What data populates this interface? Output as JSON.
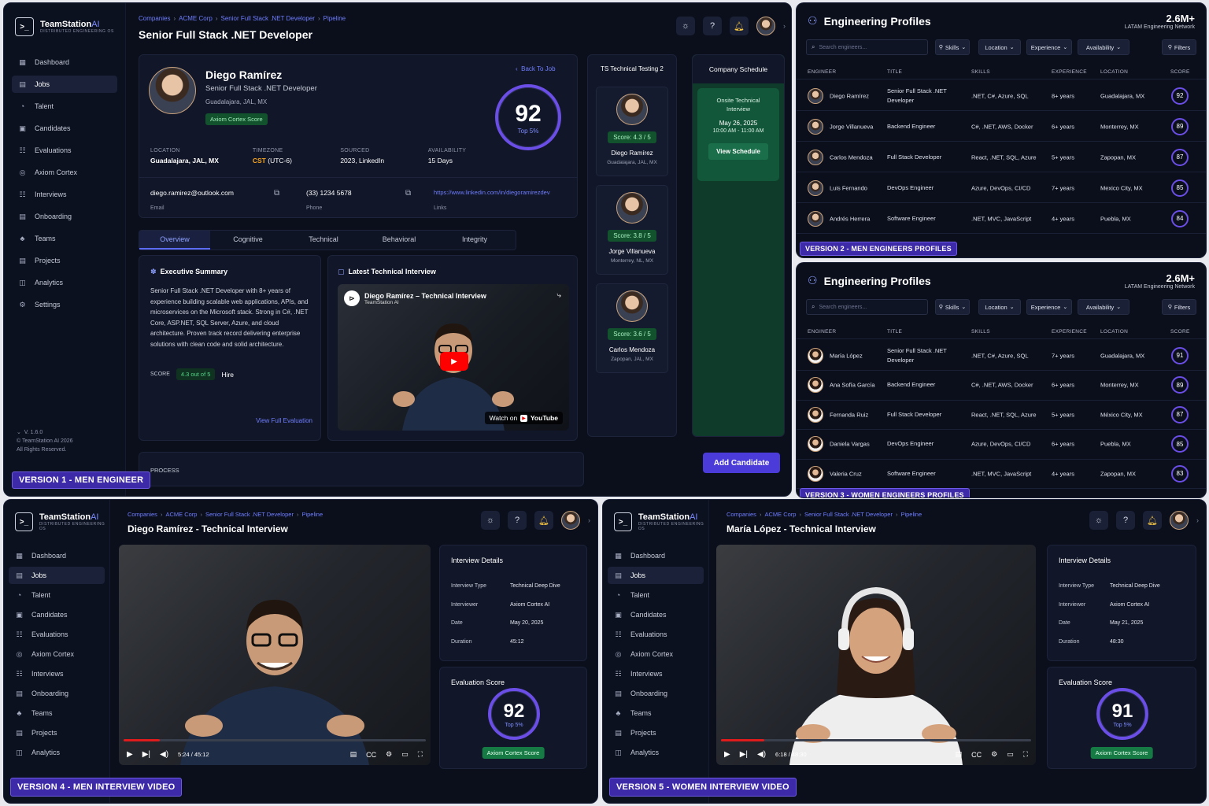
{
  "app": {
    "name_a": "TeamStation",
    "name_b": "AI",
    "subtitle": "DISTRIBUTED ENGINEERING OS",
    "logo_mark": ">_"
  },
  "nav_full": [
    "Dashboard",
    "Jobs",
    "Talent",
    "Candidates",
    "Evaluations",
    "Axiom Cortex",
    "Interviews",
    "Onboarding",
    "Teams",
    "Projects",
    "Analytics",
    "Settings"
  ],
  "nav_icons": [
    "▦",
    "▤",
    "◔",
    "▣",
    "☷",
    "◎",
    "☷",
    "▤",
    "♣",
    "▤",
    "◫",
    "⚙"
  ],
  "nav_short": [
    "Dashboard",
    "Jobs",
    "Talent",
    "Candidates",
    "Evaluations",
    "Axiom Cortex",
    "Interviews",
    "Onboarding",
    "Teams",
    "Projects",
    "Analytics"
  ],
  "version": {
    "label": "V. 1.6.0",
    "copy": "© TeamStation AI 2026",
    "rights": "All Rights Reserved."
  },
  "crumbs": [
    "Companies",
    "ACME Corp",
    "Senior Full Stack .NET Developer",
    "Pipeline"
  ],
  "v1": {
    "badge": "VERSION 1 - MEN ENGINEER",
    "title": "Senior Full Stack .NET Developer",
    "candidate": {
      "name": "Diego Ramírez",
      "role": "Senior Full Stack .NET Developer",
      "location": "Guadalajara, JAL, MX",
      "score_pill": "Axiom Cortex Score",
      "score": "92",
      "score_top": "Top 5%",
      "back": "Back To Job"
    },
    "facts": [
      {
        "label": "LOCATION",
        "value": "Guadalajara, JAL, MX"
      },
      {
        "label": "TIMEZONE",
        "value_a": "CST",
        "value_b": " (UTC-6)"
      },
      {
        "label": "SOURCED",
        "value": "2023, LinkedIn"
      },
      {
        "label": "AVAILABILITY",
        "value": "15 Days"
      }
    ],
    "contact": {
      "email": "diego.ramirez@outlook.com",
      "email_l": "Email",
      "phone": "(33) 1234 5678",
      "phone_l": "Phone",
      "link": "https://www.linkedin.com/in/diegoramirezdev",
      "link_l": "Links"
    },
    "tabs": [
      "Overview",
      "Cognitive",
      "Technical",
      "Behavioral",
      "Integrity"
    ],
    "summary": {
      "title": "Executive Summary",
      "text": "Senior Full Stack .NET Developer with 8+ years of experience building scalable web applications, APIs, and microservices on the Microsoft stack. Strong in C#, .NET Core, ASP.NET, SQL Server, Azure, and cloud architecture. Proven track record delivering enterprise solutions with clean code and solid architecture.",
      "score_l": "SCORE",
      "score_v": "4.3 out of 5",
      "hire": "Hire",
      "link": "View Full Evaluation"
    },
    "interview": {
      "title": "Latest Technical Interview",
      "video_title": "Diego Ramírez – Technical Interview",
      "channel": "TeamStation AI",
      "watch": "Watch on",
      "yt": "YouTube"
    },
    "process": "PROCESS",
    "col_a": {
      "title": "TS Technical Testing 2",
      "cards": [
        {
          "score": "Score: 4.3 / 5",
          "name": "Diego Ramírez",
          "loc": "Guadalajara, JAL, MX"
        },
        {
          "score": "Score: 3.8 / 5",
          "name": "Jorge Villanueva",
          "loc": "Monterrey, NL, MX"
        },
        {
          "score": "Score: 3.6 / 5",
          "name": "Carlos Mendoza",
          "loc": "Zapopan, JAL, MX"
        }
      ]
    },
    "col_b": {
      "title": "Company Schedule",
      "event": "Onsite Technical Interview",
      "date": "May 26, 2025",
      "time": "10:00 AM - 11:00 AM",
      "btn": "View Schedule"
    },
    "add": "Add Candidate"
  },
  "profiles_common": {
    "title": "Engineering Profiles",
    "count": "2.6M+",
    "network": "LATAM Engineering Network",
    "search": "Search engineers...",
    "filters": [
      "Skills",
      "Location",
      "Experience",
      "Availability"
    ],
    "more": "Filters",
    "headers": [
      "ENGINEER",
      "TITLE",
      "SKILLS",
      "EXPERIENCE",
      "LOCATION",
      "SCORE"
    ]
  },
  "v2": {
    "badge": "VERSION 2 - MEN ENGINEERS PROFILES",
    "rows": [
      {
        "name": "Diego Ramírez",
        "title_a": "Senior Full Stack .NET",
        "title_b": "Developer",
        "skills": ".NET, C#, Azure, SQL",
        "exp": "8+ years",
        "loc": "Guadalajara, MX",
        "score": "92"
      },
      {
        "name": "Jorge Villanueva",
        "title_a": "Backend Engineer",
        "title_b": "",
        "skills": "C#, .NET, AWS, Docker",
        "exp": "6+ years",
        "loc": "Monterrey, MX",
        "score": "89"
      },
      {
        "name": "Carlos Mendoza",
        "title_a": "Full Stack Developer",
        "title_b": "",
        "skills": "React, .NET, SQL, Azure",
        "exp": "5+ years",
        "loc": "Zapopan, MX",
        "score": "87"
      },
      {
        "name": "Luis Fernando",
        "title_a": "DevOps Engineer",
        "title_b": "",
        "skills": "Azure, DevOps, CI/CD",
        "exp": "7+ years",
        "loc": "Mexico City, MX",
        "score": "85"
      },
      {
        "name": "Andrés Herrera",
        "title_a": "Software Engineer",
        "title_b": "",
        "skills": ".NET, MVC, JavaScript",
        "exp": "4+ years",
        "loc": "Puebla, MX",
        "score": "84"
      }
    ]
  },
  "v3": {
    "badge": "VERSION 3 - WOMEN ENGINEERS PROFILES",
    "rows": [
      {
        "name": "María López",
        "title_a": "Senior Full Stack .NET",
        "title_b": "Developer",
        "skills": ".NET, C#, Azure, SQL",
        "exp": "7+ years",
        "loc": "Guadalajara, MX",
        "score": "91"
      },
      {
        "name": "Ana Sofía García",
        "title_a": "Backend Engineer",
        "title_b": "",
        "skills": "C#, .NET, AWS, Docker",
        "exp": "6+ years",
        "loc": "Monterrey, MX",
        "score": "89"
      },
      {
        "name": "Fernanda Ruiz",
        "title_a": "Full Stack Developer",
        "title_b": "",
        "skills": "React, .NET, SQL, Azure",
        "exp": "5+ years",
        "loc": "México City, MX",
        "score": "87"
      },
      {
        "name": "Daniela Vargas",
        "title_a": "DevOps Engineer",
        "title_b": "",
        "skills": "Azure, DevOps, CI/CD",
        "exp": "6+ years",
        "loc": "Puebla, MX",
        "score": "85"
      },
      {
        "name": "Valeria Cruz",
        "title_a": "Software Engineer",
        "title_b": "",
        "skills": ".NET, MVC, JavaScript",
        "exp": "4+ years",
        "loc": "Zapopan, MX",
        "score": "83"
      }
    ]
  },
  "v4": {
    "badge": "VERSION 4 - MEN INTERVIEW VIDEO",
    "title": "Diego Ramírez - Technical Interview",
    "time": "5:24 / 45:12",
    "progress": 0.12,
    "details": {
      "h": "Interview Details",
      "rows": [
        [
          "Interview Type",
          "Technical Deep Dive"
        ],
        [
          "Interviewer",
          "Axiom Cortex AI"
        ],
        [
          "Date",
          "May 20, 2025"
        ],
        [
          "Duration",
          "45:12"
        ]
      ]
    },
    "eval": {
      "h": "Evaluation Score",
      "score": "92",
      "top": "Top 5%",
      "pill": "Axiom Cortex Score"
    }
  },
  "v5": {
    "badge": "VERSION 5 - WOMEN INTERVIEW VIDEO",
    "title": "María López - Technical Interview",
    "time": "6:18 / 48:30",
    "progress": 0.14,
    "details": {
      "h": "Interview Details",
      "rows": [
        [
          "Interview Type",
          "Technical Deep Dive"
        ],
        [
          "Interviewer",
          "Axiom Cortex AI"
        ],
        [
          "Date",
          "May 21, 2025"
        ],
        [
          "Duration",
          "48:30"
        ]
      ]
    },
    "eval": {
      "h": "Evaluation Score",
      "score": "91",
      "top": "Top 5%",
      "pill": "Axiom Cortex Score"
    }
  },
  "colors": {
    "accent": "#6b4ee6",
    "link": "#6f7eff",
    "green": "#12532e",
    "badge": "#3d2aa8"
  }
}
